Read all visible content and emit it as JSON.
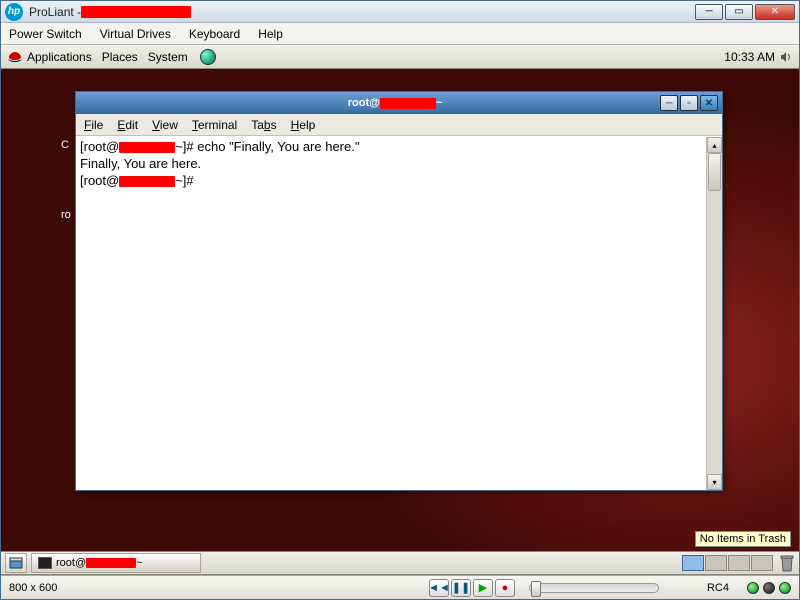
{
  "win7": {
    "title_prefix": "ProLiant - "
  },
  "outer_menu": {
    "power_switch": "Power Switch",
    "virtual_drives": "Virtual Drives",
    "keyboard": "Keyboard",
    "help": "Help"
  },
  "gnome_top": {
    "applications": "Applications",
    "places": "Places",
    "system": "System",
    "clock": "10:33 AM"
  },
  "desktop_icons": {
    "computer_initial": "C",
    "root_home": "ro"
  },
  "terminal": {
    "title_prefix": "root@",
    "title_suffix": "~",
    "menu": {
      "file": "File",
      "edit": "Edit",
      "view": "View",
      "terminal": "Terminal",
      "tabs": "Tabs",
      "help": "Help"
    },
    "lines": {
      "l1a": "[root@",
      "l1b": "~]# echo \"Finally, You are here.\"",
      "l2": "Finally, You are here.",
      "l3a": "[root@",
      "l3b": "~]# "
    }
  },
  "trash_tooltip": "No Items in Trash",
  "taskbar": {
    "task_label_prefix": "root@",
    "task_label_suffix": "~"
  },
  "statusbar": {
    "res": "800 x 600",
    "rc": "RC4"
  }
}
